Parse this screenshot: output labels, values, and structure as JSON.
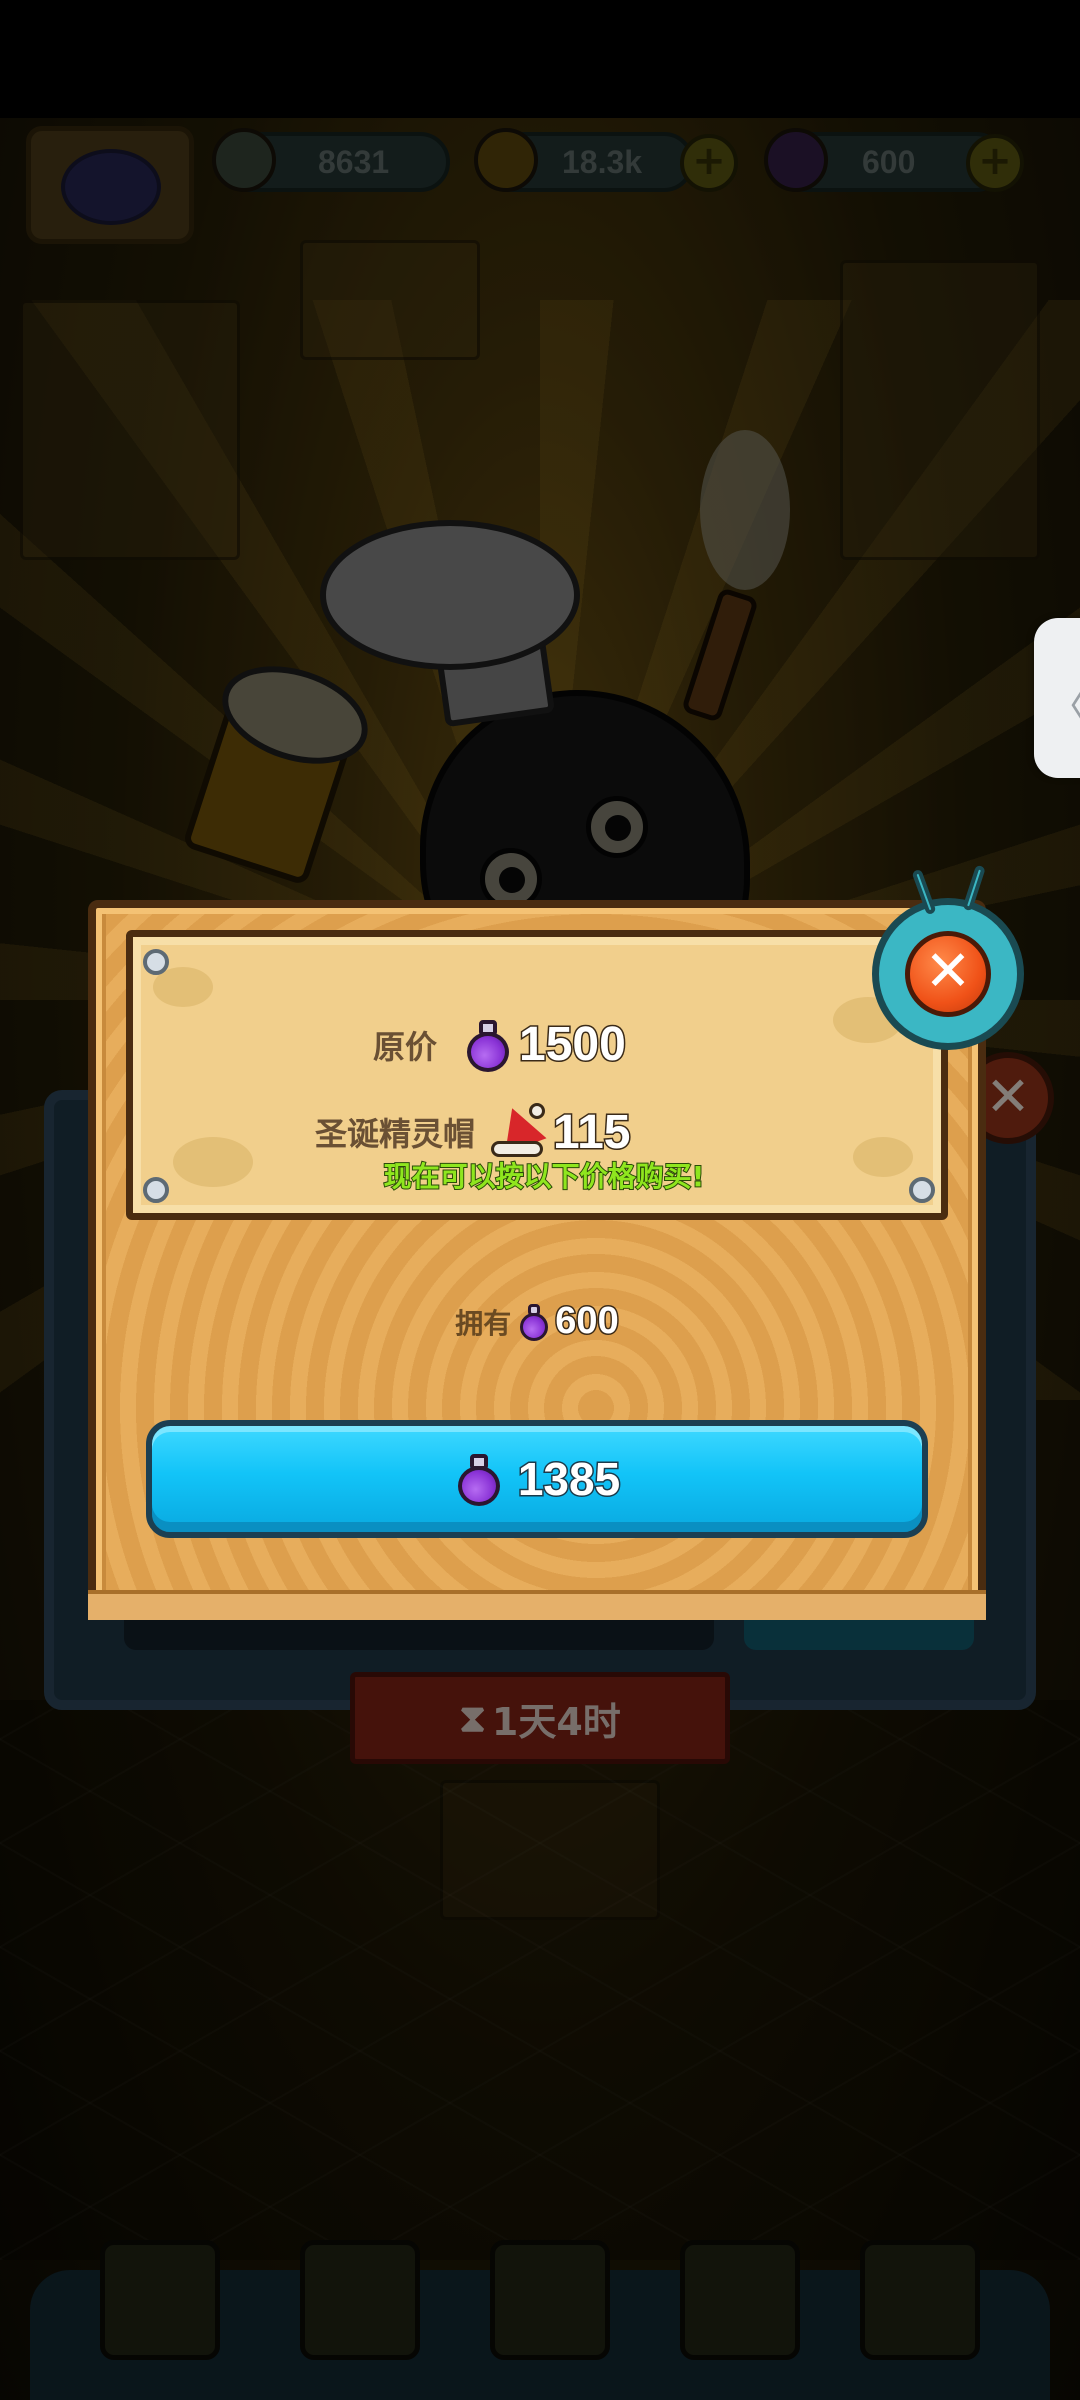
{
  "status_bar": {
    "score": "8631",
    "coins": "18.3k",
    "potions": "600"
  },
  "offer_timer": "1天4时",
  "dialog": {
    "original_price_label": "原价",
    "original_price_value": "1500",
    "discount_item_label": "圣诞精灵帽",
    "discount_item_value": "115",
    "promo_text": "现在可以按以下价格购买!",
    "own_label": "拥有",
    "own_value": "600",
    "buy_price": "1385",
    "close_symbol": "✕"
  },
  "side_handle_symbol": "〈",
  "colors": {
    "buy_button": "#12c4f8",
    "promo_text": "#8fe61e",
    "close_button": "#f05218"
  }
}
